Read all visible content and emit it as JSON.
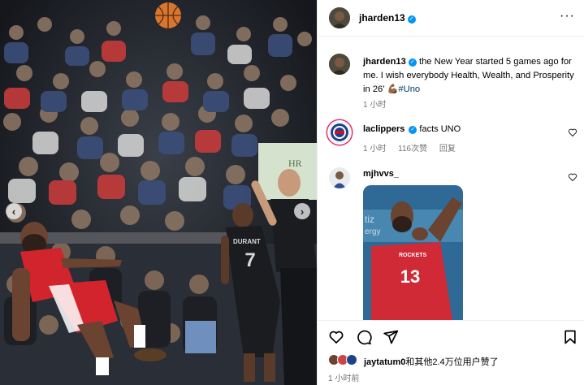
{
  "photo": {
    "description_icons": [
      "chevron-left-icon",
      "chevron-right-icon"
    ],
    "jersey_text_front": "DURANT",
    "jersey_number_front": "7"
  },
  "post": {
    "author": "jharden13",
    "more_icon": "more-horizontal-icon"
  },
  "caption": {
    "username": "jharden13",
    "text": " the New Year started 5 games ago for me. I wish everybody Health, Wealth, and Prosperity in 26’ ",
    "emoji": "💪🏾",
    "hashtag": "#Uno",
    "time": "1 小时"
  },
  "comments": [
    {
      "username": "laclippers",
      "text": "facts UNO",
      "time": "1 小时",
      "likes": "116次赞",
      "reply": "回复"
    },
    {
      "username": "mjhvvs_",
      "gif_number": "13",
      "gif_team": "ROCKETS"
    }
  ],
  "actions": {
    "like": "heart-icon",
    "comment": "comment-icon",
    "share": "send-icon",
    "save": "bookmark-icon"
  },
  "likes": {
    "first_user": "jaytatum0",
    "rest": "和其他2.4万位用户赞了"
  },
  "time_ago": "1 小时前",
  "colors": {
    "verified": "#0095f6",
    "hashtag": "#00376b",
    "secondary_text": "#737373",
    "story_ring": "#e1306c"
  }
}
